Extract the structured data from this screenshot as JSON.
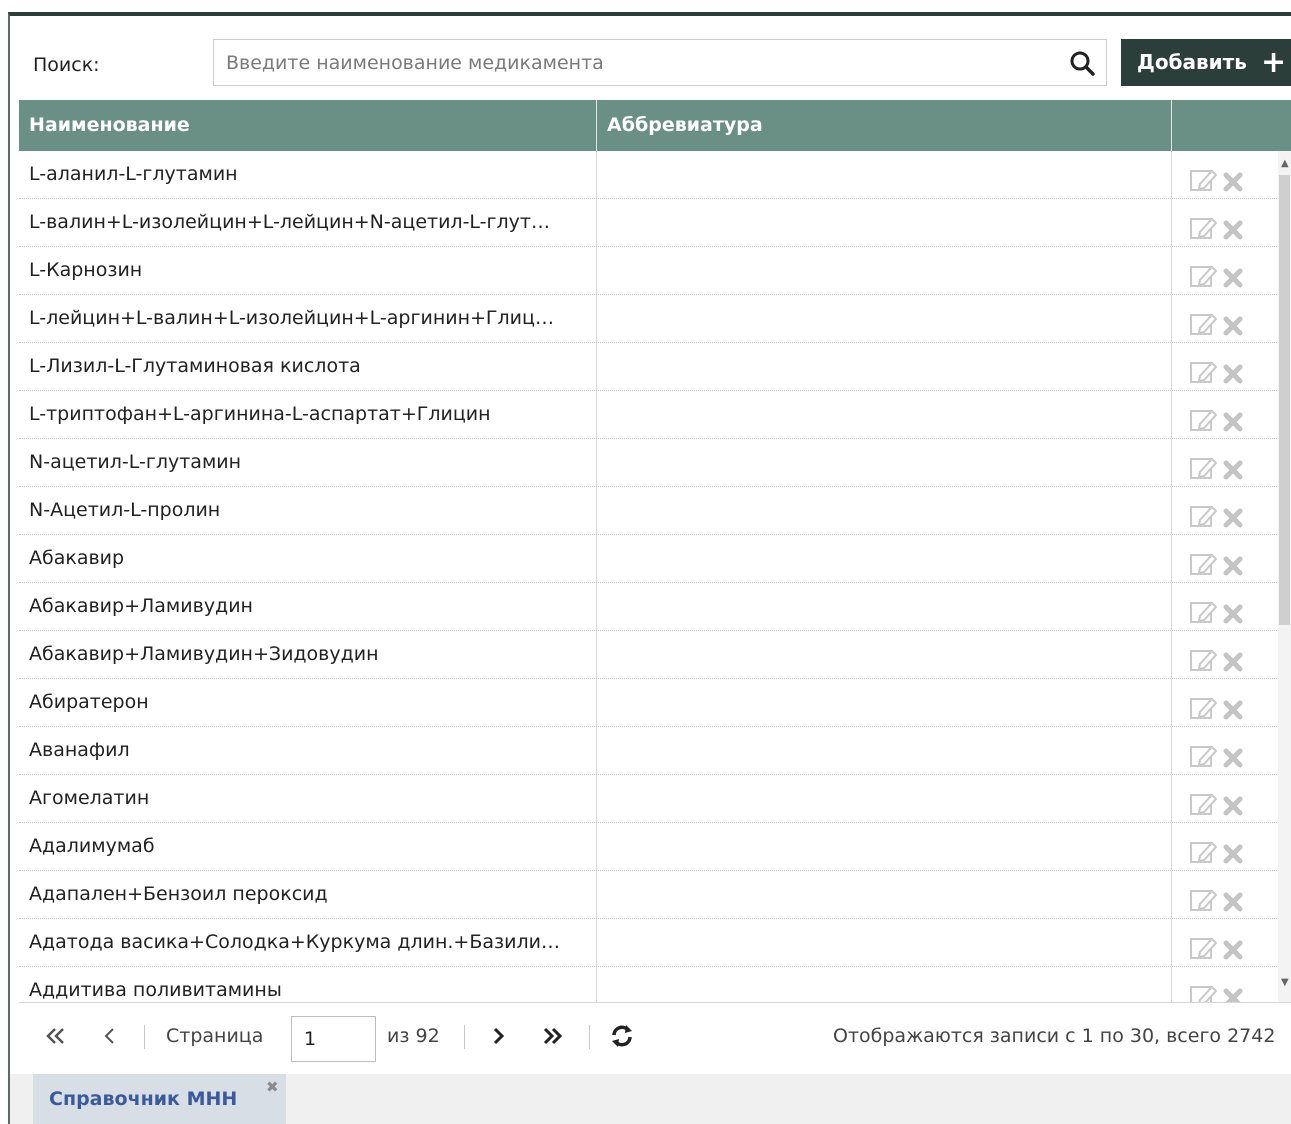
{
  "search": {
    "label": "Поиск:",
    "placeholder": "Введите наименование медикамента"
  },
  "toolbar": {
    "add_label": "Добавить",
    "add_icon": "+"
  },
  "table": {
    "columns": [
      "Наименование",
      "Аббревиатура",
      ""
    ],
    "rows": [
      {
        "name": "L-аланил-L-глутамин",
        "abbr": ""
      },
      {
        "name": "L-валин+L-изолейцин+L-лейцин+N-ацетил-L-глут…",
        "abbr": ""
      },
      {
        "name": "L-Карнозин",
        "abbr": ""
      },
      {
        "name": "L-лейцин+L-валин+L-изолейцин+L-аргинин+Глиц…",
        "abbr": ""
      },
      {
        "name": "L-Лизил-L-Глутаминовая кислота",
        "abbr": ""
      },
      {
        "name": "L-триптофан+L-аргинина-L-аспартат+Глицин",
        "abbr": ""
      },
      {
        "name": "N-ацетил-L-глутамин",
        "abbr": ""
      },
      {
        "name": "N-Ацетил-L-пролин",
        "abbr": ""
      },
      {
        "name": "Абакавир",
        "abbr": ""
      },
      {
        "name": "Абакавир+Ламивудин",
        "abbr": ""
      },
      {
        "name": "Абакавир+Ламивудин+Зидовудин",
        "abbr": ""
      },
      {
        "name": "Абиратерон",
        "abbr": ""
      },
      {
        "name": "Аванафил",
        "abbr": ""
      },
      {
        "name": "Агомелатин",
        "abbr": ""
      },
      {
        "name": "Адалимумаб",
        "abbr": ""
      },
      {
        "name": "Адапален+Бензоил пероксид",
        "abbr": ""
      },
      {
        "name": "Адатода васика+Солодка+Куркума длин.+Базили…",
        "abbr": ""
      },
      {
        "name": "Аддитива поливитамины",
        "abbr": ""
      }
    ],
    "row_actions": [
      "edit-icon",
      "delete-icon"
    ]
  },
  "pager": {
    "page_label": "Страница",
    "page_value": "1",
    "of_label": "из 92",
    "summary": "Отображаются записи с 1 по 30, всего 2742"
  },
  "tabs": [
    {
      "label": "Справочник МНН",
      "close": "✖"
    }
  ],
  "colors": {
    "header_bg": "#6a8f85",
    "button_bg": "#2b3e3a",
    "tab_text": "#3a5a9a"
  }
}
